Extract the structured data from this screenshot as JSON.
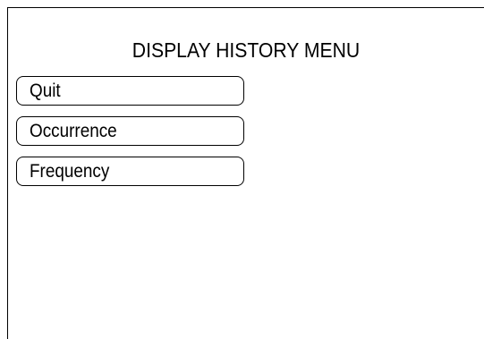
{
  "screen": {
    "title": "DISPLAY HISTORY MENU"
  },
  "menu": {
    "items": [
      {
        "label": "Quit"
      },
      {
        "label": "Occurrence"
      },
      {
        "label": "Frequency"
      }
    ]
  }
}
